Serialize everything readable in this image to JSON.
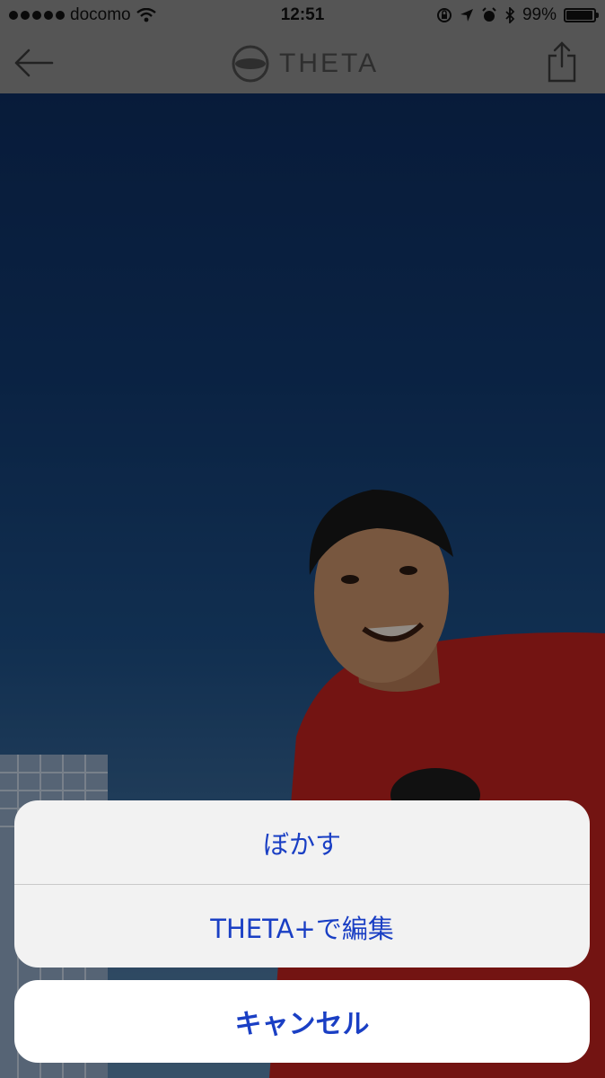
{
  "status_bar": {
    "carrier": "docomo",
    "time": "12:51",
    "battery": "99%",
    "signal_icon": "signal-dots-icon",
    "wifi_icon": "wifi-icon",
    "status_icons": [
      "rotation-lock-icon",
      "location-icon",
      "alarm-icon",
      "bluetooth-icon"
    ]
  },
  "nav": {
    "back_icon": "back-arrow-icon",
    "logo_text": "THETA",
    "share_icon": "share-icon"
  },
  "action_sheet": {
    "options": [
      {
        "label": "ぼかす"
      },
      {
        "label": "THETA+で編集"
      }
    ],
    "cancel_label": "キャンセル"
  },
  "colors": {
    "action_text": "#1a3fc4",
    "sheet_bg": "#f2f2f2",
    "cancel_bg": "#ffffff"
  }
}
